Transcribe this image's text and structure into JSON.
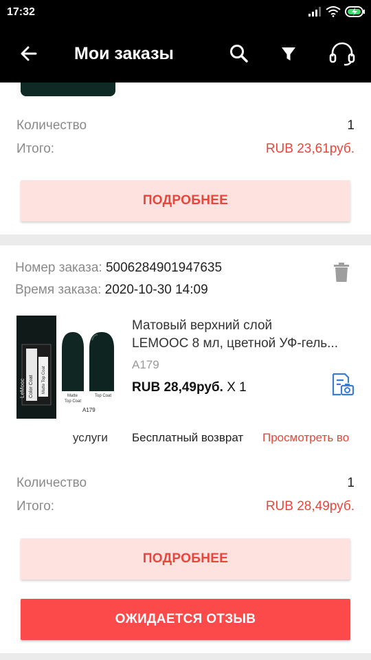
{
  "status_bar": {
    "time": "17:32"
  },
  "app_bar": {
    "title": "Мои заказы"
  },
  "order1": {
    "quantity_label": "Количество",
    "quantity_value": "1",
    "total_label": "Итого:",
    "total_value": "RUB 23,61руб.",
    "details_button": "ПОДРОБНЕЕ"
  },
  "order2": {
    "order_no_label": "Номер заказа:",
    "order_no_value": "5006284901947635",
    "order_time_label": "Время заказа:",
    "order_time_value": "2020-10-30 14:09",
    "product_title_line1": "Матовый верхний слой",
    "product_title_line2": "LEMOOC 8 мл, цветной УФ-гель...",
    "sku": "A179",
    "price": "RUB 28,49руб.",
    "qty": "X 1",
    "image_texts": {
      "bottle1": "Color Coat",
      "bottle2": "LeMooc",
      "bottle3": "Matte Top Coat",
      "nail1": "Matte",
      "nail1b": "Top Coat",
      "nail2": "Top Coat",
      "code": "A179"
    },
    "services_label": "услуги",
    "free_return": "Бесплатный возврат",
    "view_link": "Просмотреть во",
    "quantity_label": "Количество",
    "quantity_value": "1",
    "total_label": "Итого:",
    "total_value": "RUB 28,49руб.",
    "details_button": "ПОДРОБНЕЕ",
    "review_button": "ОЖИДАЕТСЯ ОТЗЫВ"
  },
  "colors": {
    "accent": "#fc4a4a",
    "accent_text": "#e8463c",
    "light_button": "#fde2df",
    "bar": "#000000"
  }
}
